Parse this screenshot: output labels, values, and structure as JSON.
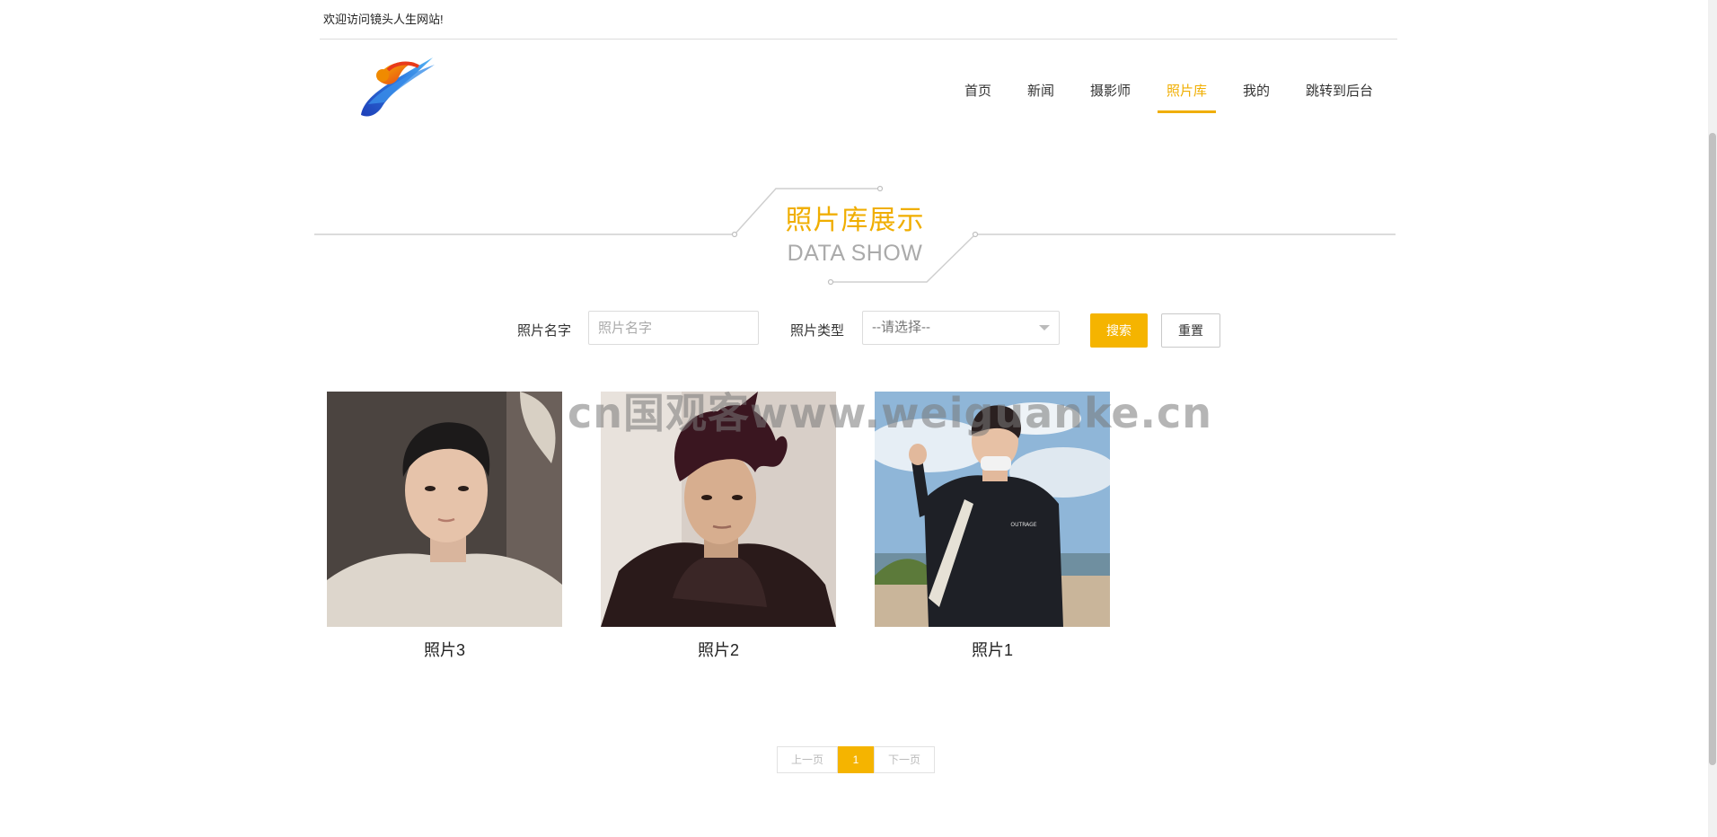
{
  "topbar": {
    "welcome": "欢迎访问镜头人生网站!"
  },
  "nav": {
    "items": [
      {
        "label": "首页",
        "active": false
      },
      {
        "label": "新闻",
        "active": false
      },
      {
        "label": "摄影师",
        "active": false
      },
      {
        "label": "照片库",
        "active": true
      },
      {
        "label": "我的",
        "active": false
      },
      {
        "label": "跳转到后台",
        "active": false
      }
    ],
    "accent_color": "#f0ae00"
  },
  "section": {
    "title_cn": "照片库展示",
    "title_en": "DATA SHOW"
  },
  "search": {
    "name_label": "照片名字",
    "name_placeholder": "照片名字",
    "type_label": "照片类型",
    "type_selected": "--请选择--",
    "search_button": "搜索",
    "reset_button": "重置"
  },
  "gallery": {
    "items": [
      {
        "caption": "照片3",
        "icon": "photo-portrait"
      },
      {
        "caption": "照片2",
        "icon": "photo-portrait"
      },
      {
        "caption": "照片1",
        "icon": "photo-portrait"
      }
    ]
  },
  "watermark": "cn国观客www.weiguanke.cn",
  "pagination": {
    "prev": "上一页",
    "current": "1",
    "next": "下一页"
  }
}
